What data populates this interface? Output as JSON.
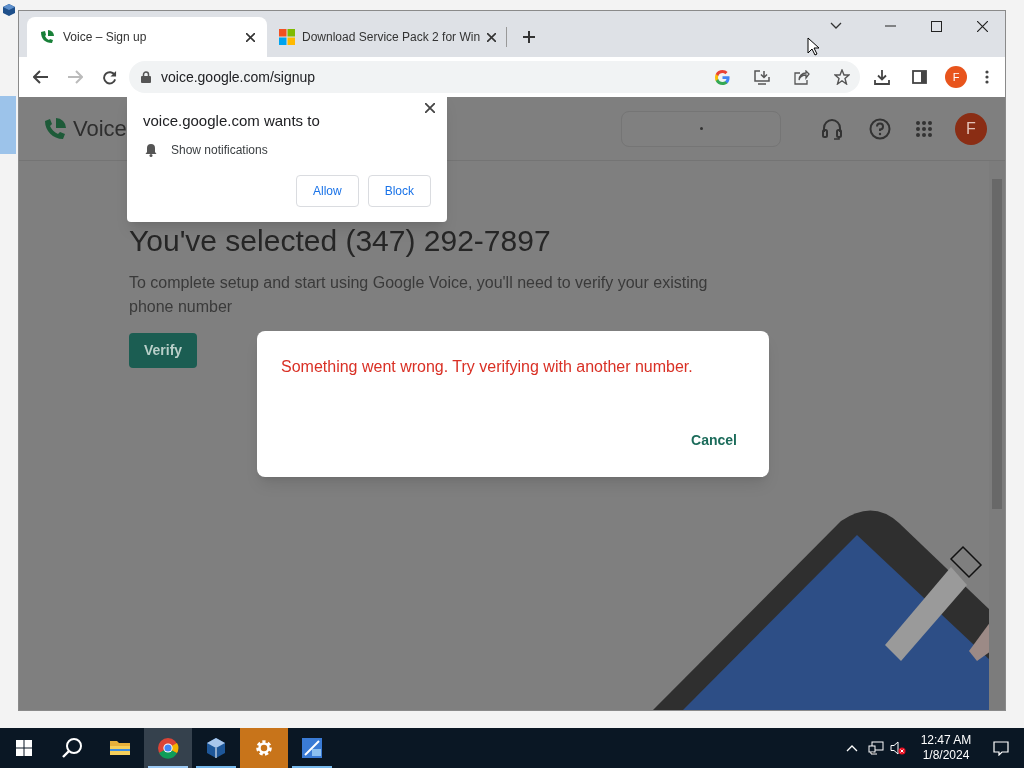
{
  "browser": {
    "tabs": [
      {
        "title": "Voice – Sign up",
        "kind": "phone",
        "selected": true
      },
      {
        "title": "Download Service Pack 2 for Win",
        "kind": "windows",
        "selected": false
      }
    ],
    "address": "voice.google.com/signup",
    "profile_initial": "F"
  },
  "permission_popup": {
    "title": "voice.google.com wants to",
    "permission": "Show notifications",
    "buttons": [
      "Allow",
      "Block"
    ]
  },
  "page": {
    "app_name": "Voice",
    "avatar_initial": "F",
    "heading": "You've selected (347) 292-7897",
    "description": "To complete setup and start using Google Voice, you'll need to verify your existing phone number",
    "verify_button": "Verify"
  },
  "dialog": {
    "message": "Something went wrong. Try verifying with another number.",
    "button": "Cancel"
  },
  "taskbar": {
    "apps": [
      {
        "kind": "explorer",
        "running": false,
        "selected": false
      },
      {
        "kind": "chrome",
        "running": true,
        "selected": true
      },
      {
        "kind": "virtualbox",
        "running": true,
        "selected": false
      },
      {
        "kind": "settings",
        "running": false,
        "selected": false
      },
      {
        "kind": "xp",
        "running": true,
        "selected": false
      }
    ],
    "time": "12:47 AM",
    "date": "1/8/2024"
  }
}
